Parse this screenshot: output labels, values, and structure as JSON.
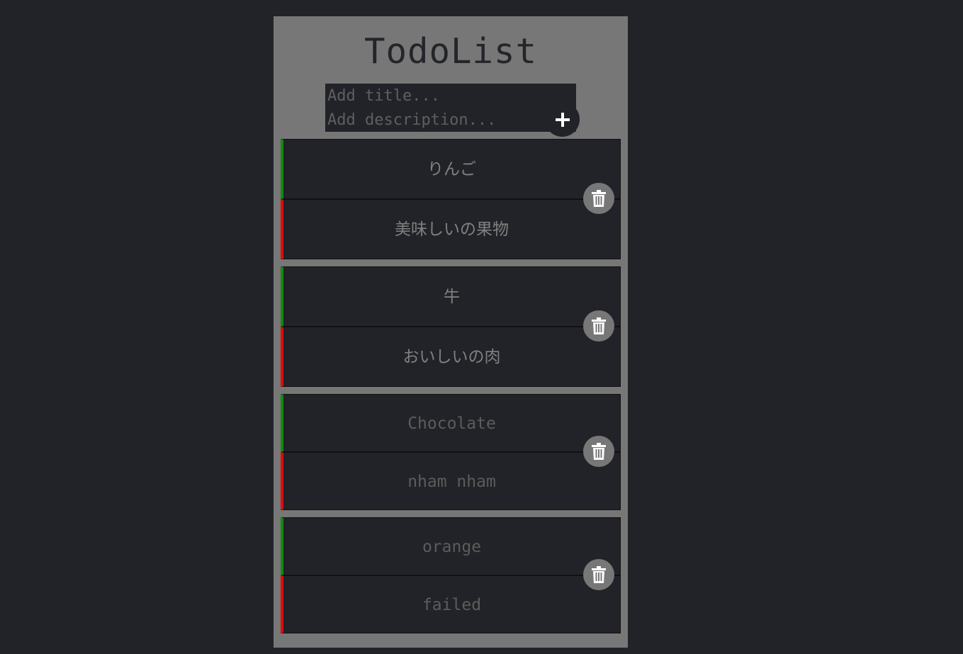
{
  "app": {
    "title": "TodoList"
  },
  "form": {
    "title_placeholder": "Add title...",
    "description_placeholder": "Add description...",
    "add_icon": "plus-icon"
  },
  "todos": [
    {
      "title": "りんご",
      "description": "美味しいの果物"
    },
    {
      "title": "牛",
      "description": "おいしいの肉"
    },
    {
      "title": "Chocolate",
      "description": "nham nham"
    },
    {
      "title": "orange",
      "description": "failed"
    }
  ],
  "icons": {
    "delete": "trash-icon"
  },
  "colors": {
    "background": "#212328",
    "panel": "#777777",
    "title_accent": "#118a11",
    "description_accent": "#d80f0f"
  }
}
